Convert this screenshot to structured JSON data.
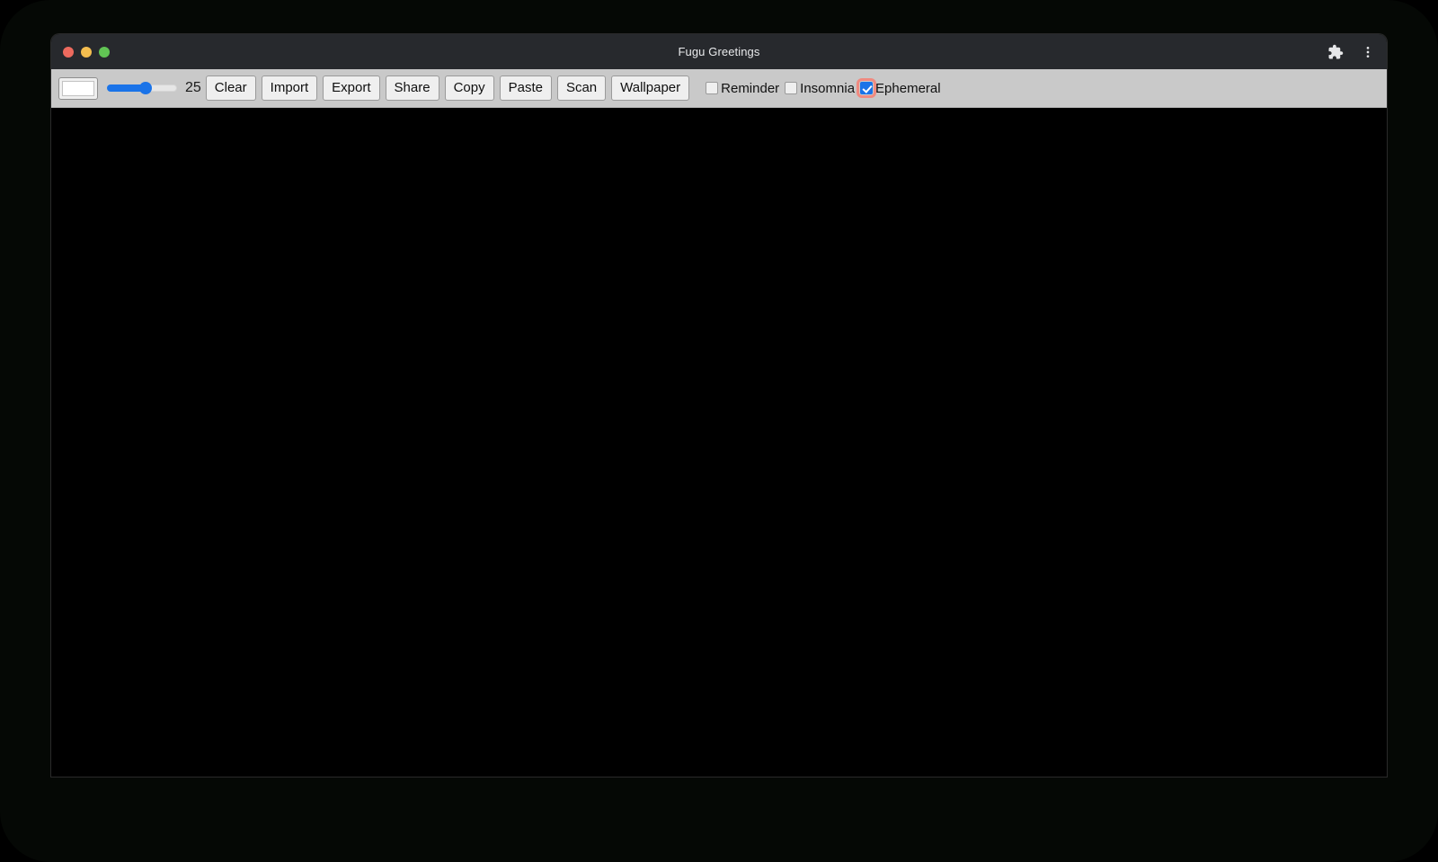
{
  "window": {
    "title": "Fugu Greetings",
    "traffic_lights": [
      {
        "name": "close",
        "color": "#ED6A5E"
      },
      {
        "name": "minimize",
        "color": "#F4BD4F"
      },
      {
        "name": "maximize",
        "color": "#61C454"
      }
    ],
    "actions": [
      {
        "name": "extensions-icon",
        "label": "Extensions"
      },
      {
        "name": "more-menu-icon",
        "label": "Customize and control"
      }
    ]
  },
  "toolbar": {
    "color_picker": {
      "name": "color-picker",
      "value": "#ffffff"
    },
    "slider": {
      "name": "line-width-slider",
      "value": 25,
      "min": 0,
      "max": 50,
      "percent": 55,
      "display_value": "25"
    },
    "buttons": [
      {
        "name": "clear-button",
        "label": "Clear"
      },
      {
        "name": "import-button",
        "label": "Import"
      },
      {
        "name": "export-button",
        "label": "Export"
      },
      {
        "name": "share-button",
        "label": "Share"
      },
      {
        "name": "copy-button",
        "label": "Copy"
      },
      {
        "name": "paste-button",
        "label": "Paste"
      },
      {
        "name": "scan-button",
        "label": "Scan"
      },
      {
        "name": "wallpaper-button",
        "label": "Wallpaper"
      }
    ],
    "checkboxes": [
      {
        "name": "reminder-checkbox",
        "label": "Reminder",
        "checked": false,
        "focused": false
      },
      {
        "name": "insomnia-checkbox",
        "label": "Insomnia",
        "checked": false,
        "focused": false
      },
      {
        "name": "ephemeral-checkbox",
        "label": "Ephemeral",
        "checked": true,
        "focused": true
      }
    ]
  },
  "canvas": {
    "name": "drawing-canvas",
    "background": "#000000"
  },
  "colors": {
    "accent": "#1a73e8",
    "focus_ring": "#f08a80",
    "toolbar_bg": "#c9c9c9",
    "titlebar_bg": "#27292d",
    "bezel": "#050805"
  }
}
